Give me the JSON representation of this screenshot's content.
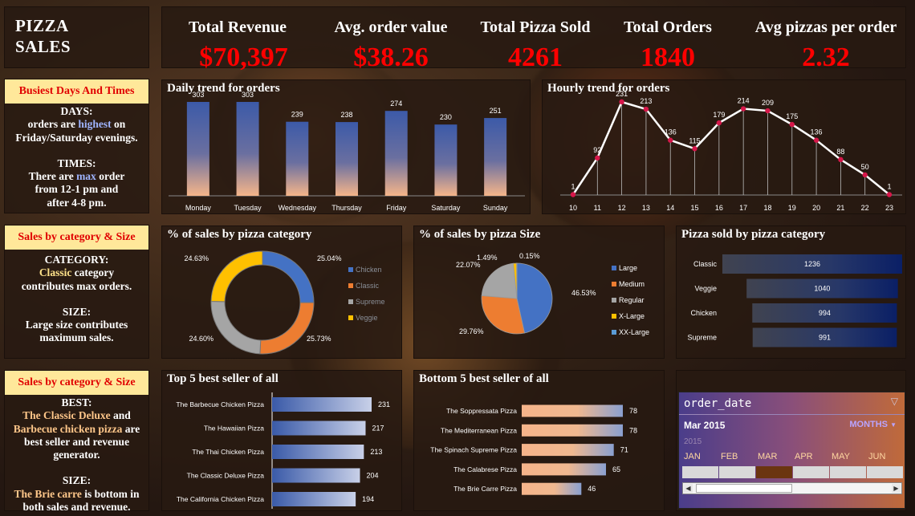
{
  "dashboard": {
    "title_line1": "PIZZA",
    "title_line2": "SALES"
  },
  "kpis": [
    {
      "label": "Total Revenue",
      "value": "$70,397"
    },
    {
      "label": "Avg. order value",
      "value": "$38.26"
    },
    {
      "label": "Total Pizza Sold",
      "value": "4261"
    },
    {
      "label": "Total Orders",
      "value": "1840"
    },
    {
      "label": "Avg pizzas per order",
      "value": "2.32"
    }
  ],
  "insights": {
    "busiest": {
      "head": "Busiest Days And Times",
      "days_title": "DAYS:",
      "days_l1_a": "orders are ",
      "days_l1_b": "highest",
      "days_l1_c": " on",
      "days_l2": "Friday/Saturday evenings.",
      "times_title": "TIMES:",
      "times_l1_a": "There are ",
      "times_l1_b": "max",
      "times_l1_c": " order",
      "times_l2": "from 12-1 pm and",
      "times_l3": "after 4-8 pm."
    },
    "category": {
      "head": "Sales by category & Size",
      "cat_title": "CATEGORY:",
      "cat_l1_a": "Classic",
      "cat_l1_b": " category",
      "cat_l2": "contributes max orders.",
      "size_title": "SIZE:",
      "size_l1": "Large size contributes",
      "size_l2": "maximum sales."
    },
    "best": {
      "head": "Sales by category & Size",
      "best_title": "BEST:",
      "best_l1_a": "The Classic Deluxe",
      "best_l1_b": " and",
      "best_l2_a": "Barbecue chicken pizza",
      "best_l2_b": " are",
      "best_l3": "best seller and revenue",
      "best_l4": "generator.",
      "size_title": "SIZE:",
      "size_l1_a": "The Brie carre",
      "size_l1_b": " is bottom in",
      "size_l2": "both sales and revenue."
    }
  },
  "charts": {
    "daily": {
      "title": "Daily trend for orders"
    },
    "hourly": {
      "title": "Hourly trend for orders"
    },
    "category_pct": {
      "title": "% of sales by pizza category"
    },
    "size_pct": {
      "title": "% of sales by pizza Size"
    },
    "sold_by_cat": {
      "title": "Pizza sold by pizza category"
    },
    "top5": {
      "title": "Top 5 best seller of all"
    },
    "bottom5": {
      "title": "Bottom 5 best seller of all"
    }
  },
  "chart_data": [
    {
      "id": "daily",
      "type": "bar",
      "title": "Daily trend for orders",
      "categories": [
        "Monday",
        "Tuesday",
        "Wednesday",
        "Thursday",
        "Friday",
        "Saturday",
        "Sunday"
      ],
      "values": [
        303,
        303,
        239,
        238,
        274,
        230,
        251
      ]
    },
    {
      "id": "hourly",
      "type": "line",
      "title": "Hourly trend for orders",
      "x": [
        "10",
        "11",
        "12",
        "13",
        "14",
        "15",
        "16",
        "17",
        "18",
        "19",
        "20",
        "21",
        "22",
        "23"
      ],
      "values": [
        1,
        92,
        231,
        213,
        136,
        115,
        179,
        214,
        209,
        175,
        136,
        88,
        50,
        1
      ]
    },
    {
      "id": "category_pct",
      "type": "pie",
      "title": "% of sales by pizza category",
      "categories": [
        "Chicken",
        "Classic",
        "Supreme",
        "Veggie"
      ],
      "values": [
        25.04,
        25.73,
        24.6,
        24.63
      ],
      "labels": [
        "25.04%",
        "25.73%",
        "24.60%",
        "24.63%"
      ],
      "colors": [
        "#4472c4",
        "#ed7d31",
        "#a5a5a5",
        "#ffc000"
      ]
    },
    {
      "id": "size_pct",
      "type": "pie",
      "title": "% of sales by pizza Size",
      "categories": [
        "Large",
        "Medium",
        "Regular",
        "X-Large",
        "XX-Large"
      ],
      "values": [
        46.53,
        29.76,
        22.07,
        1.49,
        0.15
      ],
      "labels": [
        "46.53%",
        "29.76%",
        "22.07%",
        "1.49%",
        "0.15%"
      ],
      "colors": [
        "#4472c4",
        "#ed7d31",
        "#a5a5a5",
        "#ffc000",
        "#5b9bd5"
      ]
    },
    {
      "id": "sold_by_cat",
      "type": "bar",
      "title": "Pizza sold by pizza category",
      "categories": [
        "Classic",
        "Veggie",
        "Chicken",
        "Supreme"
      ],
      "values": [
        1236,
        1040,
        994,
        991
      ]
    },
    {
      "id": "top5",
      "type": "bar",
      "title": "Top 5 best seller of all",
      "categories": [
        "The Barbecue Chicken Pizza",
        "The Hawaiian Pizza",
        "The Thai Chicken Pizza",
        "The Classic Deluxe Pizza",
        "The California Chicken Pizza"
      ],
      "values": [
        231,
        217,
        213,
        204,
        194
      ]
    },
    {
      "id": "bottom5",
      "type": "bar",
      "title": "Bottom 5 best seller of all",
      "categories": [
        "The Soppressata Pizza",
        "The Mediterranean Pizza",
        "The Spinach Supreme Pizza",
        "The Calabrese Pizza",
        "The Brie Carre Pizza"
      ],
      "values": [
        78,
        78,
        71,
        65,
        46
      ]
    }
  ],
  "slicer": {
    "title": "order_date",
    "selected": "Mar 2015",
    "period": "MONTHS",
    "year": "2015",
    "months": [
      "JAN",
      "FEB",
      "MAR",
      "APR",
      "MAY",
      "JUN"
    ],
    "selected_month": "MAR",
    "filter_icon": "filter-icon",
    "dropdown_icon": "caret-down-icon",
    "colors": {
      "selected_tile": "#6b3510",
      "tile": "#d9d9d9",
      "month_text": "#ffd7a0"
    }
  },
  "theme": {
    "kpi_value": "#ff0000",
    "insight_head_bg": "#ffe89a",
    "insight_head_text": "#e00000"
  }
}
